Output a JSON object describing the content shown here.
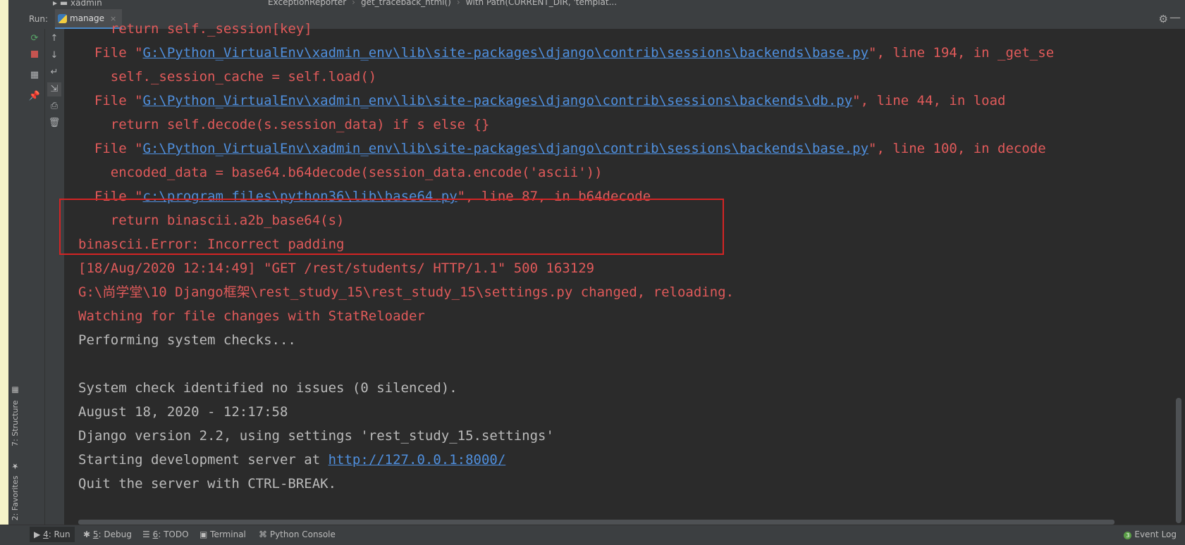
{
  "top": {
    "tree_item": "xadmin",
    "breadcrumbs": [
      "ExceptionReporter",
      "get_traceback_html()",
      "with Path(CURRENT_DIR, 'templat..."
    ]
  },
  "run_panel": {
    "label": "Run:",
    "tab_name": "manage",
    "tab_close": "×"
  },
  "side_labels": {
    "structure": "7: Structure",
    "favorites": "2: Favorites"
  },
  "console": {
    "lines": [
      {
        "kind": "err",
        "pre": "    return self._session[key]",
        "link": "",
        "post": ""
      },
      {
        "kind": "err",
        "pre": "  File \"",
        "link": "G:\\Python_VirtualEnv\\xadmin_env\\lib\\site-packages\\django\\contrib\\sessions\\backends\\base.py",
        "post": "\", line 194, in _get_se"
      },
      {
        "kind": "err",
        "pre": "    self._session_cache = self.load()",
        "link": "",
        "post": ""
      },
      {
        "kind": "err",
        "pre": "  File \"",
        "link": "G:\\Python_VirtualEnv\\xadmin_env\\lib\\site-packages\\django\\contrib\\sessions\\backends\\db.py",
        "post": "\", line 44, in load"
      },
      {
        "kind": "err",
        "pre": "    return self.decode(s.session_data) if s else {}",
        "link": "",
        "post": ""
      },
      {
        "kind": "err",
        "pre": "  File \"",
        "link": "G:\\Python_VirtualEnv\\xadmin_env\\lib\\site-packages\\django\\contrib\\sessions\\backends\\base.py",
        "post": "\", line 100, in decode"
      },
      {
        "kind": "err",
        "pre": "    encoded_data = base64.b64decode(session_data.encode('ascii'))",
        "link": "",
        "post": ""
      },
      {
        "kind": "err",
        "pre": "  File \"",
        "link": "c:\\program files\\python36\\lib\\base64.py",
        "post": "\", line 87, in b64decode"
      },
      {
        "kind": "err",
        "pre": "    return binascii.a2b_base64(s)",
        "link": "",
        "post": ""
      },
      {
        "kind": "err",
        "pre": "binascii.Error: Incorrect padding",
        "link": "",
        "post": ""
      },
      {
        "kind": "err",
        "pre": "[18/Aug/2020 12:14:49] \"GET /rest/students/ HTTP/1.1\" 500 163129",
        "link": "",
        "post": ""
      },
      {
        "kind": "err",
        "pre": "G:\\尚学堂\\10 Django框架\\rest_study_15\\rest_study_15\\settings.py changed, reloading.",
        "link": "",
        "post": ""
      },
      {
        "kind": "err",
        "pre": "Watching for file changes with StatReloader",
        "link": "",
        "post": ""
      },
      {
        "kind": "norm",
        "pre": "Performing system checks...",
        "link": "",
        "post": ""
      },
      {
        "kind": "norm",
        "pre": "",
        "link": "",
        "post": ""
      },
      {
        "kind": "norm",
        "pre": "System check identified no issues (0 silenced).",
        "link": "",
        "post": ""
      },
      {
        "kind": "norm",
        "pre": "August 18, 2020 - 12:17:58",
        "link": "",
        "post": ""
      },
      {
        "kind": "norm",
        "pre": "Django version 2.2, using settings 'rest_study_15.settings'",
        "link": "",
        "post": ""
      },
      {
        "kind": "norm",
        "pre": "Starting development server at ",
        "link": "http://127.0.0.1:8000/",
        "post": ""
      },
      {
        "kind": "norm",
        "pre": "Quit the server with CTRL-BREAK.",
        "link": "",
        "post": ""
      }
    ]
  },
  "bottom_tabs": [
    {
      "num": "4",
      "label": ": Run",
      "icon": "run-icon"
    },
    {
      "num": "5",
      "label": ": Debug",
      "icon": "debug-icon"
    },
    {
      "num": "6",
      "label": ": TODO",
      "icon": "todo-icon"
    },
    {
      "num": "",
      "label": "Terminal",
      "icon": "terminal-icon"
    },
    {
      "num": "",
      "label": "Python Console",
      "icon": "python-console-icon"
    }
  ],
  "event_log": {
    "count": "3",
    "label": "Event Log"
  },
  "colors": {
    "error": "#e05a5a",
    "normal": "#bbbbbb",
    "link": "#4f8fdd",
    "highlight_box": "#d42424"
  }
}
